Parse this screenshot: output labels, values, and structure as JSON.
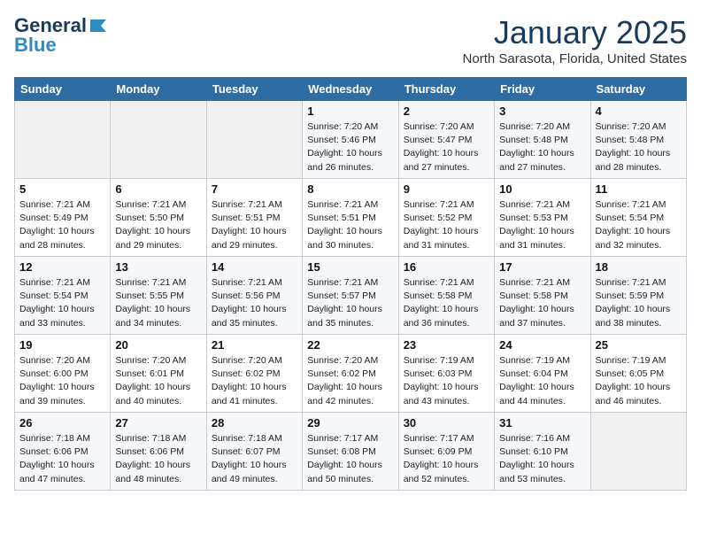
{
  "logo": {
    "line1": "General",
    "line2": "Blue"
  },
  "title": "January 2025",
  "location": "North Sarasota, Florida, United States",
  "weekdays": [
    "Sunday",
    "Monday",
    "Tuesday",
    "Wednesday",
    "Thursday",
    "Friday",
    "Saturday"
  ],
  "weeks": [
    [
      {
        "day": "",
        "info": ""
      },
      {
        "day": "",
        "info": ""
      },
      {
        "day": "",
        "info": ""
      },
      {
        "day": "1",
        "info": "Sunrise: 7:20 AM\nSunset: 5:46 PM\nDaylight: 10 hours\nand 26 minutes."
      },
      {
        "day": "2",
        "info": "Sunrise: 7:20 AM\nSunset: 5:47 PM\nDaylight: 10 hours\nand 27 minutes."
      },
      {
        "day": "3",
        "info": "Sunrise: 7:20 AM\nSunset: 5:48 PM\nDaylight: 10 hours\nand 27 minutes."
      },
      {
        "day": "4",
        "info": "Sunrise: 7:20 AM\nSunset: 5:48 PM\nDaylight: 10 hours\nand 28 minutes."
      }
    ],
    [
      {
        "day": "5",
        "info": "Sunrise: 7:21 AM\nSunset: 5:49 PM\nDaylight: 10 hours\nand 28 minutes."
      },
      {
        "day": "6",
        "info": "Sunrise: 7:21 AM\nSunset: 5:50 PM\nDaylight: 10 hours\nand 29 minutes."
      },
      {
        "day": "7",
        "info": "Sunrise: 7:21 AM\nSunset: 5:51 PM\nDaylight: 10 hours\nand 29 minutes."
      },
      {
        "day": "8",
        "info": "Sunrise: 7:21 AM\nSunset: 5:51 PM\nDaylight: 10 hours\nand 30 minutes."
      },
      {
        "day": "9",
        "info": "Sunrise: 7:21 AM\nSunset: 5:52 PM\nDaylight: 10 hours\nand 31 minutes."
      },
      {
        "day": "10",
        "info": "Sunrise: 7:21 AM\nSunset: 5:53 PM\nDaylight: 10 hours\nand 31 minutes."
      },
      {
        "day": "11",
        "info": "Sunrise: 7:21 AM\nSunset: 5:54 PM\nDaylight: 10 hours\nand 32 minutes."
      }
    ],
    [
      {
        "day": "12",
        "info": "Sunrise: 7:21 AM\nSunset: 5:54 PM\nDaylight: 10 hours\nand 33 minutes."
      },
      {
        "day": "13",
        "info": "Sunrise: 7:21 AM\nSunset: 5:55 PM\nDaylight: 10 hours\nand 34 minutes."
      },
      {
        "day": "14",
        "info": "Sunrise: 7:21 AM\nSunset: 5:56 PM\nDaylight: 10 hours\nand 35 minutes."
      },
      {
        "day": "15",
        "info": "Sunrise: 7:21 AM\nSunset: 5:57 PM\nDaylight: 10 hours\nand 35 minutes."
      },
      {
        "day": "16",
        "info": "Sunrise: 7:21 AM\nSunset: 5:58 PM\nDaylight: 10 hours\nand 36 minutes."
      },
      {
        "day": "17",
        "info": "Sunrise: 7:21 AM\nSunset: 5:58 PM\nDaylight: 10 hours\nand 37 minutes."
      },
      {
        "day": "18",
        "info": "Sunrise: 7:21 AM\nSunset: 5:59 PM\nDaylight: 10 hours\nand 38 minutes."
      }
    ],
    [
      {
        "day": "19",
        "info": "Sunrise: 7:20 AM\nSunset: 6:00 PM\nDaylight: 10 hours\nand 39 minutes."
      },
      {
        "day": "20",
        "info": "Sunrise: 7:20 AM\nSunset: 6:01 PM\nDaylight: 10 hours\nand 40 minutes."
      },
      {
        "day": "21",
        "info": "Sunrise: 7:20 AM\nSunset: 6:02 PM\nDaylight: 10 hours\nand 41 minutes."
      },
      {
        "day": "22",
        "info": "Sunrise: 7:20 AM\nSunset: 6:02 PM\nDaylight: 10 hours\nand 42 minutes."
      },
      {
        "day": "23",
        "info": "Sunrise: 7:19 AM\nSunset: 6:03 PM\nDaylight: 10 hours\nand 43 minutes."
      },
      {
        "day": "24",
        "info": "Sunrise: 7:19 AM\nSunset: 6:04 PM\nDaylight: 10 hours\nand 44 minutes."
      },
      {
        "day": "25",
        "info": "Sunrise: 7:19 AM\nSunset: 6:05 PM\nDaylight: 10 hours\nand 46 minutes."
      }
    ],
    [
      {
        "day": "26",
        "info": "Sunrise: 7:18 AM\nSunset: 6:06 PM\nDaylight: 10 hours\nand 47 minutes."
      },
      {
        "day": "27",
        "info": "Sunrise: 7:18 AM\nSunset: 6:06 PM\nDaylight: 10 hours\nand 48 minutes."
      },
      {
        "day": "28",
        "info": "Sunrise: 7:18 AM\nSunset: 6:07 PM\nDaylight: 10 hours\nand 49 minutes."
      },
      {
        "day": "29",
        "info": "Sunrise: 7:17 AM\nSunset: 6:08 PM\nDaylight: 10 hours\nand 50 minutes."
      },
      {
        "day": "30",
        "info": "Sunrise: 7:17 AM\nSunset: 6:09 PM\nDaylight: 10 hours\nand 52 minutes."
      },
      {
        "day": "31",
        "info": "Sunrise: 7:16 AM\nSunset: 6:10 PM\nDaylight: 10 hours\nand 53 minutes."
      },
      {
        "day": "",
        "info": ""
      }
    ]
  ]
}
